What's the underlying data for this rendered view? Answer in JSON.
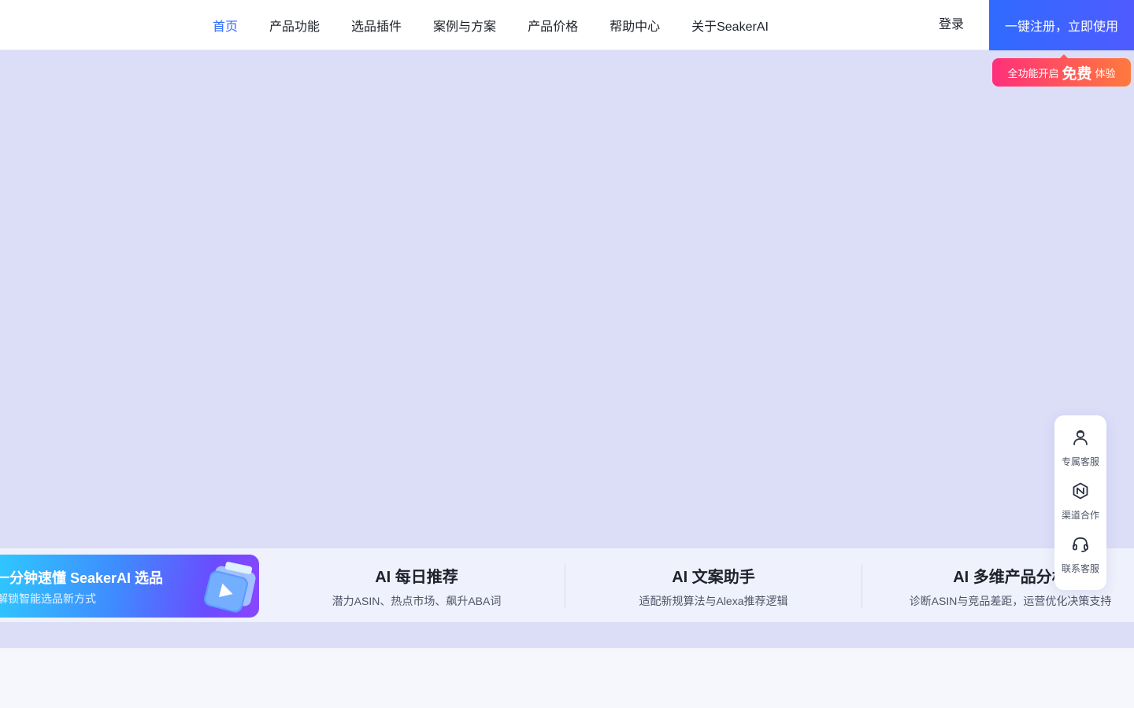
{
  "nav": {
    "items": [
      {
        "label": "首页",
        "active": true
      },
      {
        "label": "产品功能",
        "active": false
      },
      {
        "label": "选品插件",
        "active": false
      },
      {
        "label": "案例与方案",
        "active": false
      },
      {
        "label": "产品价格",
        "active": false
      },
      {
        "label": "帮助中心",
        "active": false
      },
      {
        "label": "关于SeakerAI",
        "active": false
      }
    ],
    "login_label": "登录",
    "register_label": "一键注册，立即使用"
  },
  "promo": {
    "prefix": "全功能开启",
    "highlight": "免费",
    "suffix": "体验"
  },
  "video_card": {
    "title": "一分钟速懂 SeakerAI 选品",
    "subtitle": "解锁智能选品新方式"
  },
  "features": [
    {
      "title": "AI 每日推荐",
      "subtitle": "潜力ASIN、热点市场、飙升ABA词"
    },
    {
      "title": "AI 文案助手",
      "subtitle": "适配新规算法与Alexa推荐逻辑"
    },
    {
      "title": "AI 多维产品分析",
      "subtitle": "诊断ASIN与竞品差距，运营优化决策支持"
    }
  ],
  "side_panel": {
    "items": [
      {
        "label": "专属客服",
        "icon": "customer-service-person-icon"
      },
      {
        "label": "渠道合作",
        "icon": "partnership-handshake-icon"
      },
      {
        "label": "联系客服",
        "icon": "headset-icon"
      }
    ]
  },
  "colors": {
    "primary": "#2f6bff",
    "hero_bg": "#dcdef8",
    "promo_start": "#ff2f7a",
    "promo_end": "#ff7a3d"
  }
}
